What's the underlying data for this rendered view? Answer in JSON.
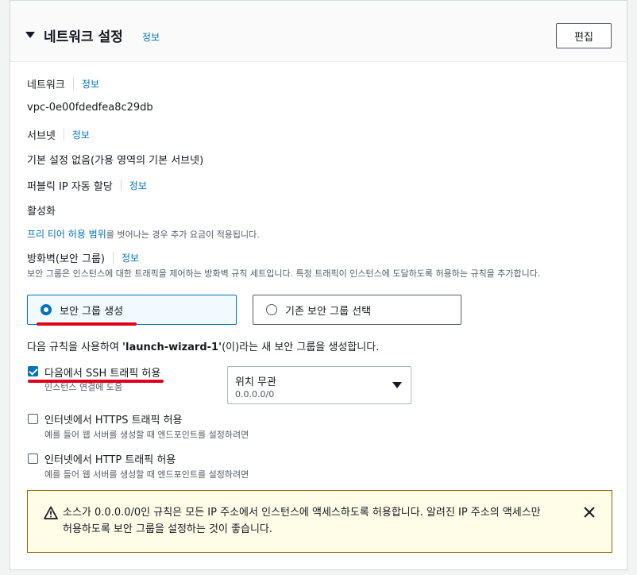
{
  "header": {
    "title": "네트워크 설정",
    "info": "정보",
    "edit_label": "편집"
  },
  "network": {
    "label": "네트워크",
    "info": "정보",
    "value": "vpc-0e00fdedfea8c29db"
  },
  "subnet": {
    "label": "서브넷",
    "info": "정보",
    "value": "기본 설정 없음(가용 영역의 기본 서브넷)"
  },
  "public_ip": {
    "label": "퍼블릭 IP 자동 할당",
    "info": "정보",
    "value": "활성화"
  },
  "free_tier": {
    "link": "프리 티어 허용 범위",
    "text": "를 벗어나는 경우 추가 요금이 적용됩니다."
  },
  "firewall": {
    "label": "방화벽(보안 그룹)",
    "info": "정보",
    "description": "보안 그룹은 인스턴스에 대한 트래픽을 제어하는 방화벽 규칙 세트입니다. 특정 트래픽이 인스턴스에 도달하도록 허용하는 규칙을 추가합니다.",
    "options": [
      {
        "label": "보안 그룹 생성",
        "selected": true
      },
      {
        "label": "기존 보안 그룹 선택",
        "selected": false
      }
    ],
    "rule_text_before": "다음 규칙을 사용하여 ",
    "rule_text_name": "'launch-wizard-1'",
    "rule_text_after": "(이)라는 새 보안 그룹을 생성합니다."
  },
  "rules": [
    {
      "label": "다음에서 SSH 트래픽 허용",
      "sub": "인스턴스 연결에 도움",
      "checked": true
    },
    {
      "label": "인터넷에서 HTTPS 트래픽 허용",
      "sub": "예를 들어 웹 서버를 생성할 때 엔드포인트를 설정하려면",
      "checked": false
    },
    {
      "label": "인터넷에서 HTTP 트래픽 허용",
      "sub": "예를 들어 웹 서버를 생성할 때 엔드포인트를 설정하려면",
      "checked": false
    }
  ],
  "ssh_source": {
    "title": "위치 무관",
    "sub": "0.0.0.0/0"
  },
  "warning": {
    "text": "소스가 0.0.0.0/0인 규칙은 모든 IP 주소에서 인스턴스에 액세스하도록 허용합니다. 알려진 IP 주소의 액세스만 허용하도록 보안 그룹을 설정하는 것이 좋습니다."
  },
  "colors": {
    "link": "#0073bb",
    "annotation": "#e0001b",
    "warning_border": "#8d6605"
  }
}
